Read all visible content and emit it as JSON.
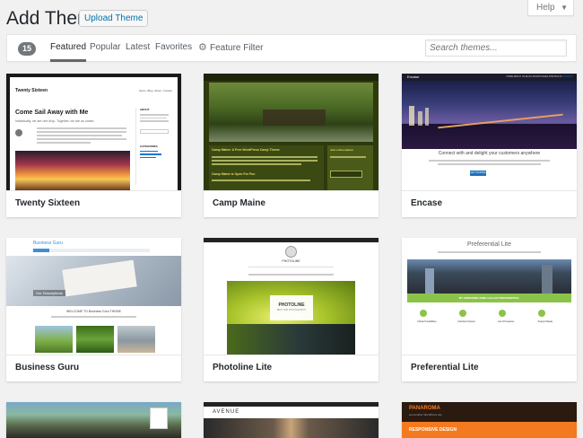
{
  "header": {
    "title": "Add Themes",
    "upload_label": "Upload Theme",
    "help_label": "Help",
    "help_caret": "▼"
  },
  "filter": {
    "count": "15",
    "tabs": [
      {
        "label": "Featured",
        "current": true
      },
      {
        "label": "Popular"
      },
      {
        "label": "Latest"
      },
      {
        "label": "Favorites"
      }
    ],
    "feature_filter_label": "Feature Filter",
    "search_placeholder": "Search themes..."
  },
  "themes": [
    {
      "name": "Twenty Sixteen",
      "site_title": "Twenty Sixteen",
      "post_title": "Come Sail Away with Me",
      "post_subtitle": "Individually, we are one drop. Together, we are an ocean.",
      "nav": [
        "Home",
        "Blog",
        "About",
        "Contact"
      ],
      "sidebar_about": "ABOUT",
      "sidebar_categories": "CATEGORIES"
    },
    {
      "name": "Camp Maine",
      "heading": "Camp Maine: A Free WordPress Camp Theme",
      "sub_heading": "Camp Maine is Open For Fun",
      "side_title": "Just a Description"
    },
    {
      "name": "Encase",
      "brand": "Encase",
      "menu": [
        "HOME",
        "ABOUT US",
        "BLOG",
        "SHORTCODES",
        "PORTFOLIO",
        "CONTACT"
      ],
      "tagline": "Connect with and delight your customers anywhere",
      "button": "GET STARTED"
    },
    {
      "name": "Business Guru",
      "brand": "Business Guru",
      "hero_caption": "Our Descriptions",
      "welcome": "WELCOME TO Business Guru THEME"
    },
    {
      "name": "Photoline Lite",
      "brand": "PHOTOLINE",
      "hero_label": "PHOTOLINE",
      "hero_sub": "BEST FOR PHOTOGRAPHY"
    },
    {
      "name": "Preferential Lite",
      "brand": "Preferential Lite",
      "band_title": "MY AWESOME HOME CALLED PREFERENTIAL",
      "features": [
        "Infinite Possibilities",
        "Unlimited Colours",
        "Lots Of Features",
        "Support Ready"
      ]
    },
    {
      "name": ""
    },
    {
      "name": "",
      "brand": "AVENUE"
    },
    {
      "name": "",
      "brand": "PANAROMA",
      "sub": "just another WordPress site",
      "hero": "RESPONSIVE DESIGN"
    }
  ],
  "colors": {
    "accent": "#0073aa",
    "camp_maine_bg": "#3b4a12",
    "camp_maine_text": "#e8d96b",
    "encase_accent": "#1e73be",
    "business_guru_accent": "#3b8fd6",
    "preferential_band": "#8bc34a",
    "panaroma_orange": "#f47a20"
  }
}
